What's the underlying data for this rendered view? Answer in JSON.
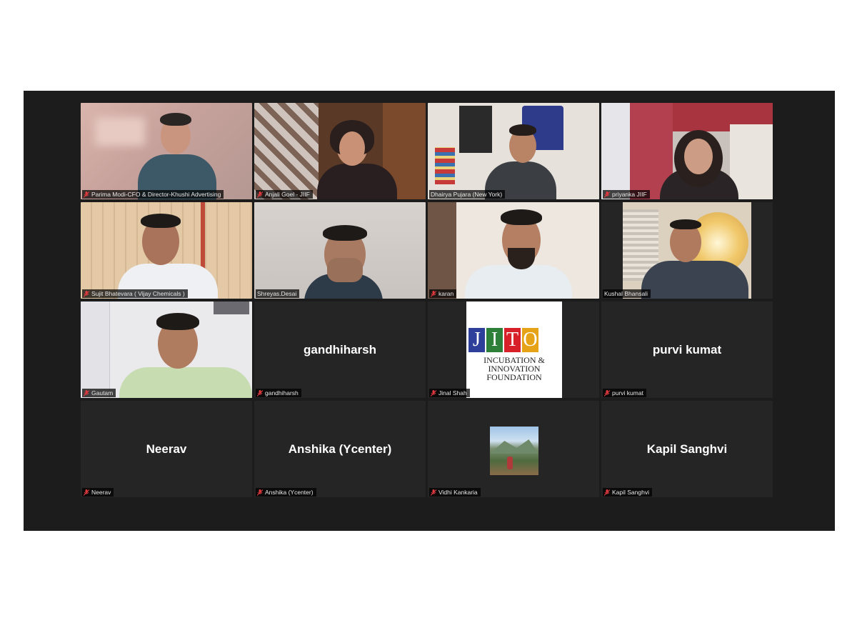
{
  "participants": [
    {
      "label": "Parima Modi-CFO & Director-Khushi Advertising"
    },
    {
      "label": "Anjali Goel - JIIF"
    },
    {
      "label": "Dhairya Pujara (New York)"
    },
    {
      "label": "priyanka JIIF"
    },
    {
      "label": "Sujit Bhatevara ( Vijay Chemicals )"
    },
    {
      "label": "Shreyas.Desai"
    },
    {
      "label": "karan"
    },
    {
      "label": "Kushal Bhansali"
    },
    {
      "label": "Gautam"
    },
    {
      "label": "gandhiharsh",
      "display_name": "gandhiharsh"
    },
    {
      "label": "Jinal Shah"
    },
    {
      "label": "purvi kumat",
      "display_name": "purvi kumat"
    },
    {
      "label": "Neerav",
      "display_name": "Neerav"
    },
    {
      "label": "Anshika (Ycenter)",
      "display_name": "Anshika (Ycenter)"
    },
    {
      "label": "Vidhi Kankaria"
    },
    {
      "label": "Kapil Sanghvi",
      "display_name": "Kapil Sanghvi"
    }
  ],
  "logo": {
    "letters": [
      "J",
      "I",
      "T",
      "O"
    ],
    "letter_colors": [
      "#2d3f9a",
      "#2d7f3a",
      "#d8202a",
      "#e6a317"
    ],
    "lines": [
      "INCUBATION &",
      "INNOVATION",
      "FOUNDATION"
    ]
  },
  "colors": {
    "active_speaker_border": "#b9d43a",
    "tile_background": "#252525",
    "window_background": "#1c1c1c",
    "muted_mic": "#e0393e"
  }
}
